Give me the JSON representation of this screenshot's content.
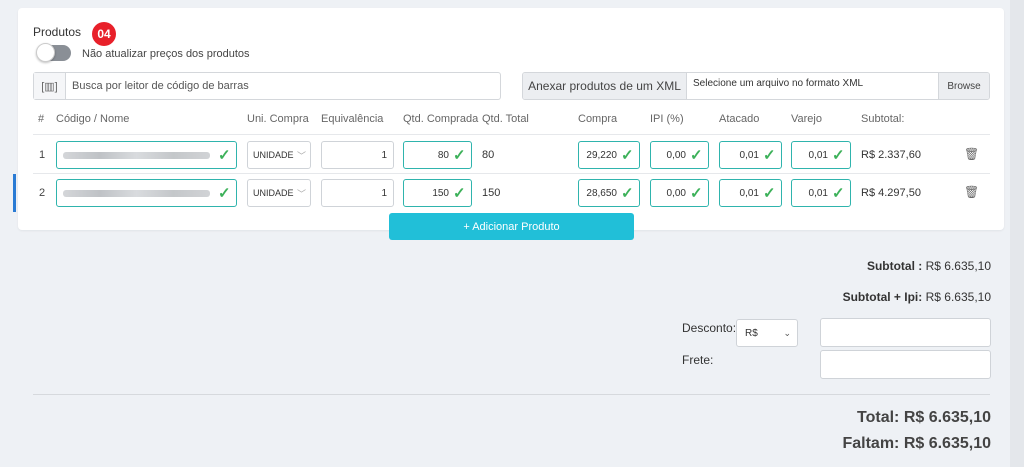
{
  "section": {
    "title": "Produtos",
    "step_badge": "04"
  },
  "toggle": {
    "label": "Não atualizar preços dos produtos",
    "on": false
  },
  "barcode": {
    "placeholder": "Busca por leitor de código de barras",
    "icon": "barcode-scan-icon"
  },
  "xml": {
    "label": "Anexar produtos de um XML",
    "file_text": "Selecione um arquivo no formato XML",
    "browse": "Browse"
  },
  "table": {
    "headers": [
      "#",
      "Código / Nome",
      "Uni. Compra",
      "Equivalência",
      "Qtd. Comprada",
      "Qtd. Total",
      "Compra",
      "IPI (%)",
      "Atacado",
      "Varejo",
      "Subtotal:"
    ],
    "rows": [
      {
        "num": "1",
        "unidade": "UNIDADE",
        "equivalencia": "1",
        "qtd_comprada": "80",
        "qtd_total": "80",
        "compra": "29,220",
        "ipi": "0,00",
        "atacado": "0,01",
        "varejo": "0,01",
        "subtotal": "R$ 2.337,60"
      },
      {
        "num": "2",
        "unidade": "UNIDADE",
        "equivalencia": "1",
        "qtd_comprada": "150",
        "qtd_total": "150",
        "compra": "28,650",
        "ipi": "0,00",
        "atacado": "0,01",
        "varejo": "0,01",
        "subtotal": "R$ 4.297,50"
      }
    ]
  },
  "add_button": "+ Adicionar Produto",
  "totals": {
    "subtotal_label": "Subtotal :",
    "subtotal_value": "R$ 6.635,10",
    "subtotal_ipi_label": "Subtotal + Ipi:",
    "subtotal_ipi_value": "R$ 6.635,10",
    "desconto_label": "Desconto:",
    "desconto_currency": "R$",
    "frete_label": "Frete:",
    "total": "Total: R$ 6.635,10",
    "faltam": "Faltam: R$ 6.635,10"
  },
  "colors": {
    "accent": "#21bfd8",
    "badge": "#e8202a",
    "valid_border": "#2fb4ad",
    "check": "#3db15a",
    "row_accent": "#2a7bd4"
  }
}
